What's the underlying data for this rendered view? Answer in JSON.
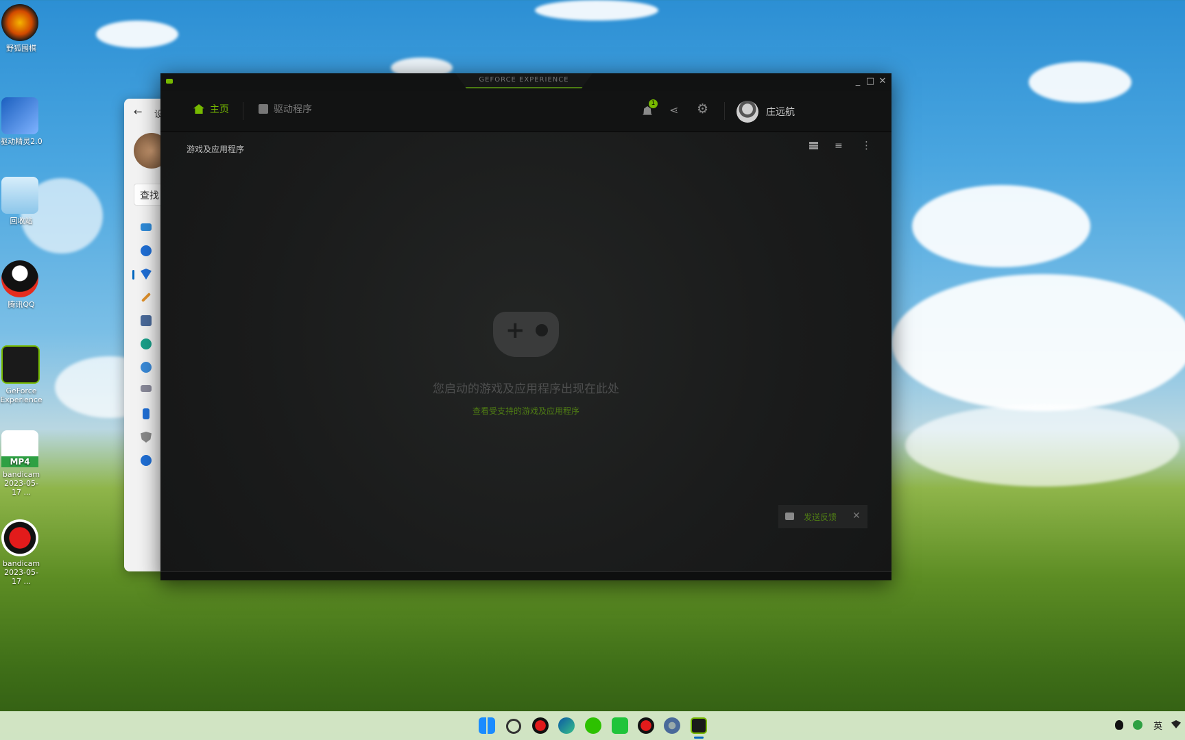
{
  "desktop": {
    "icons": [
      {
        "label": "野狐围棋"
      },
      {
        "label": "驱动精灵2.0"
      },
      {
        "label": "回收站"
      },
      {
        "label": "腾讯QQ"
      },
      {
        "label": "GeForce Experience"
      },
      {
        "label": "bandicam 2023-05-17 ..."
      },
      {
        "label": "bandicam 2023-05-17 ..."
      }
    ],
    "mp4_badge": "MP4"
  },
  "settings_window": {
    "title_partial": "设",
    "search_placeholder": "查找"
  },
  "gfe": {
    "title": "GEFORCE EXPERIENCE",
    "nav": {
      "home": "主页",
      "drivers": "驱动程序",
      "notification_count": "1",
      "username": "庄远航"
    },
    "section_title": "游戏及应用程序",
    "empty_message": "您启动的游戏及应用程序出现在此处",
    "supported_link": "查看受支持的游戏及应用程序",
    "feedback": "发送反馈"
  },
  "taskbar": {
    "ime": "英"
  },
  "colors": {
    "accent_green": "#76b900",
    "window_bg": "#1a1b1b"
  }
}
